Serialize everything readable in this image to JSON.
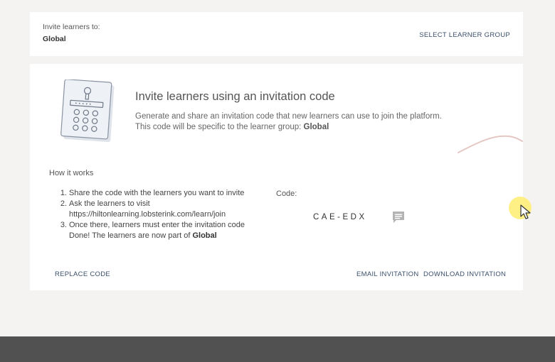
{
  "header": {
    "invite_to_label": "Invite learners to:",
    "invite_to_value": "Global",
    "select_group_label": "SELECT LEARNER GROUP"
  },
  "main": {
    "title": "Invite learners using an invitation code",
    "description_line1": "Generate and share an invitation code that new learners can use to join the platform.",
    "description_line2_prefix": "This code will be specific to the learner group: ",
    "description_group": "Global",
    "illustration_icon": "keypad-lock-icon"
  },
  "how_it_works": {
    "title": "How it works",
    "step1_num": "1.",
    "step1": "Share the code with the learners you want to invite",
    "step2_num": "2.",
    "step2": "Ask the learners to visit",
    "step2_url": "https://hiltonlearning.lobsterink.com/learn/join",
    "step3_num": "3.",
    "step3": "Once there, learners must enter the invitation code",
    "done_prefix": "Done! The learners are now part of ",
    "done_group": "Global"
  },
  "code": {
    "label": "Code:",
    "value": "CAE-EDX",
    "copy_icon": "copy-chat-icon"
  },
  "footer": {
    "replace_label": "REPLACE CODE",
    "email_label": "EMAIL INVITATION",
    "download_label": "DOWNLOAD INVITATION"
  },
  "colors": {
    "accent_link": "#3b4f6b",
    "background": "#f4f3f1",
    "card": "#ffffff",
    "bottom_bar": "#515151",
    "cursor_highlight": "#ffee78"
  }
}
